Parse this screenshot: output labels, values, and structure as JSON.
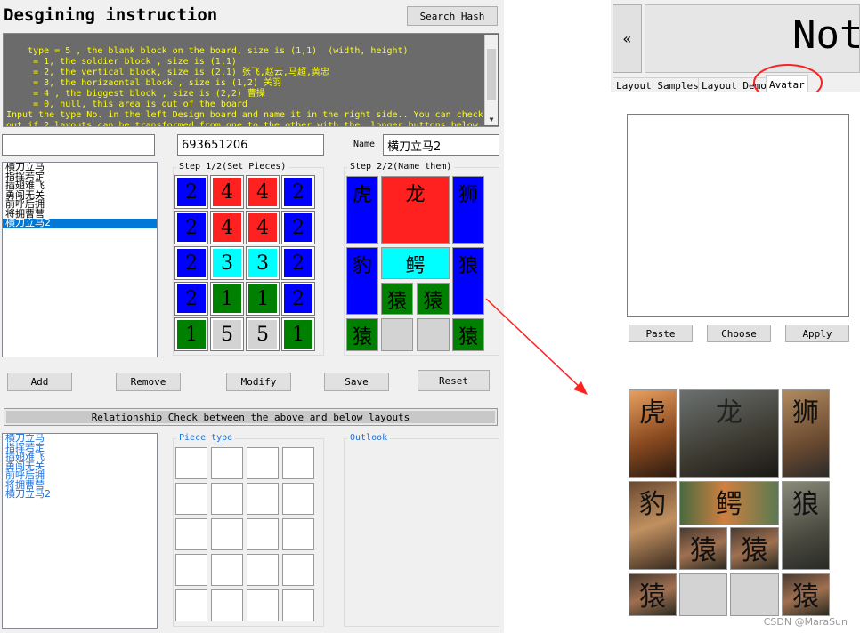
{
  "title": "Desgining instruction",
  "search_hash_label": "Search Hash",
  "description": "type = 5 , the blank block on the board, size is (1,1)  (width, height)\n     = 1, the soldier block , size is (1,1)\n     = 2, the vertical block, size is (2,1) 张飞,赵云,马超,黄忠\n     = 3, the horizaontal block , size is (1,2) 关羽\n     = 4 , the biggest block , size is (2,2) 曹操\n     = 0, null, this area is out of the board\nInput the type No. in the left Design board and name it in the right side.. You can check\nout if 2 layouts can be transformed from one to the other with the  longer buttons below.",
  "hash_input_value": "",
  "hash_value": "693651206",
  "name_label": "Name",
  "name_value": "横刀立马2",
  "layout_list": [
    "横刀立马",
    "指挥若定",
    "插翅难飞",
    "勇闯无关",
    "前呼后拥",
    "将拥曹营",
    "横刀立马2"
  ],
  "selected_layout": "横刀立马2",
  "step1_label": "Step 1/2(Set Pieces)",
  "step2_label": "Step 2/2(Name them)",
  "piece_grid": [
    [
      "2",
      "4",
      "4",
      "2"
    ],
    [
      "2",
      "4",
      "4",
      "2"
    ],
    [
      "2",
      "3",
      "3",
      "2"
    ],
    [
      "2",
      "1",
      "1",
      "2"
    ],
    [
      "1",
      "5",
      "5",
      "1"
    ]
  ],
  "piece_names": {
    "hu": "虎",
    "long": "龙",
    "shi": "狮",
    "bao": "豹",
    "e": "鳄",
    "lang": "狼",
    "yuan": "猿"
  },
  "buttons": {
    "add": "Add",
    "remove": "Remove",
    "modify": "Modify",
    "save": "Save",
    "reset": "Reset"
  },
  "relationship_check_label": "Relationship Check between the above and below layouts",
  "lower_list": [
    "横刀立马",
    "指挥若定",
    "插翅难飞",
    "勇闯无关",
    "前呼后拥",
    "将拥曹营",
    "横刀立马2"
  ],
  "piece_type_label": "Piece type",
  "outlook_label": "Outlook",
  "right": {
    "collapse": "«",
    "not_text": "Not",
    "tabs": [
      "Layout Samples",
      "Layout Demo",
      "Avatar"
    ],
    "active_tab": "Avatar",
    "paste": "Paste",
    "choose": "Choose",
    "apply": "Apply"
  },
  "watermark": "CSDN @MaraSun",
  "colors": {
    "type1": "#008000",
    "type2": "#0000ff",
    "type3": "#00ffff",
    "type4": "#ff2020",
    "type5": "#d3d3d3",
    "annotation": "#ff2020",
    "desc_bg": "#6b6b6b",
    "desc_text": "#ffff00"
  }
}
